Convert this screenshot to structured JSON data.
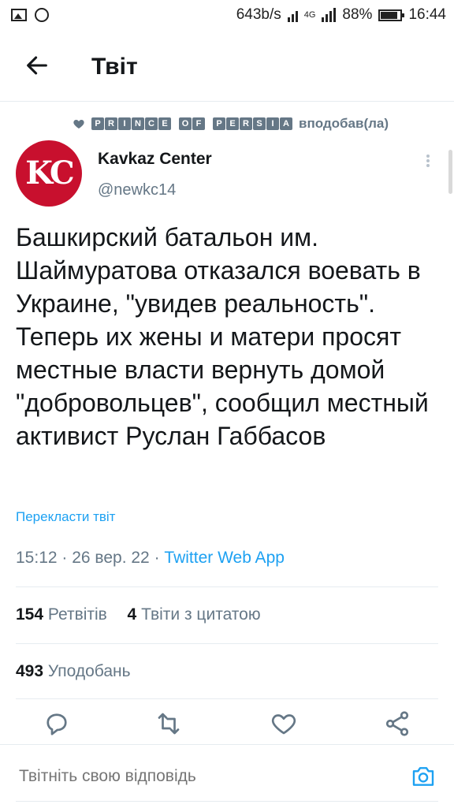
{
  "status": {
    "speed": "643b/s",
    "network": "4G",
    "battery": "88%",
    "time": "16:44"
  },
  "header": {
    "title": "Твіт"
  },
  "social_context": {
    "badge_words": [
      "PRINCE",
      "OF",
      "PERSIA"
    ],
    "text": "вподобав(ла)"
  },
  "tweet": {
    "avatar_text": "KC",
    "author": "Kavkaz Center",
    "handle": "@newkc14",
    "text": "Башкирский батальон им. Шаймуратова отказался воевать в Украине, \"увидев реальность\". Теперь их жены и матери просят местные власти вернуть домой \"добровольцев\", сообщил местный активист Руслан Габбасов",
    "translate": "Перекласти твіт",
    "time": "15:12",
    "date": "26 вер. 22",
    "source": "Twitter Web App",
    "retweets_count": "154",
    "retweets_label": "Ретвітів",
    "quotes_count": "4",
    "quotes_label": "Твіти з цитатою",
    "likes_count": "493",
    "likes_label": "Уподобань"
  },
  "actions": {
    "icons": [
      "reply-icon",
      "retweet-icon",
      "like-icon",
      "share-icon"
    ]
  },
  "reply": {
    "placeholder": "Твітніть свою відповідь"
  },
  "colors": {
    "accent": "#1da1f2",
    "muted": "#657786",
    "text": "#14171a",
    "avatar": "#c8102e"
  }
}
